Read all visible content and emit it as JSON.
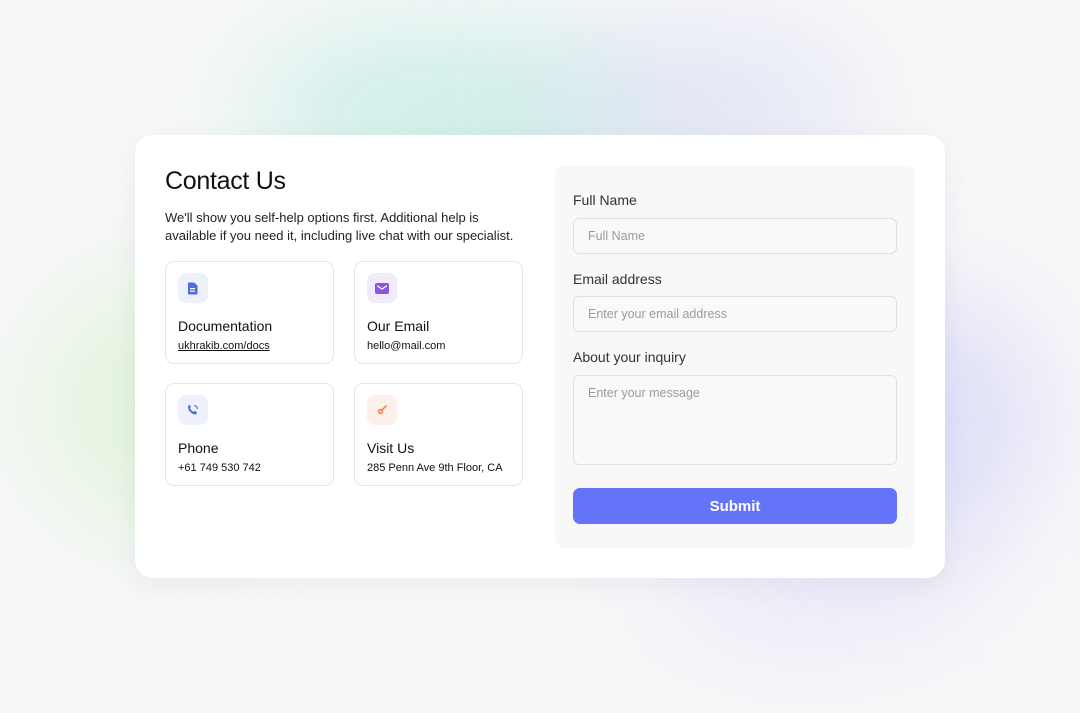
{
  "contact": {
    "title": "Contact Us",
    "subtitle": "We'll show you self-help options first. Additional help is available if you need it, including live chat with our specialist."
  },
  "info_cards": [
    {
      "title": "Documentation",
      "value": "ukhrakib.com/docs",
      "icon": "document-icon",
      "accent": "#4a6fd8",
      "icon_bg": "#eef1fb"
    },
    {
      "title": "Our Email",
      "value": "hello@mail.com",
      "icon": "mail-icon",
      "accent": "#8a55e0",
      "icon_bg": "#f1ebfc"
    },
    {
      "title": "Phone",
      "value": "+61 749 530 742",
      "icon": "phone-icon",
      "accent": "#4a6fd8",
      "icon_bg": "#eef1fb"
    },
    {
      "title": "Visit Us",
      "value": "285 Penn Ave 9th Floor, CA",
      "icon": "location-pin-icon",
      "accent": "#f08a5d",
      "icon_bg": "#fdf0ea"
    }
  ],
  "form": {
    "full_name": {
      "label": "Full Name",
      "placeholder": "Full Name",
      "value": ""
    },
    "email": {
      "label": "Email address",
      "placeholder": "Enter your email address",
      "value": ""
    },
    "inquiry": {
      "label": "About your inquiry",
      "placeholder": "Enter your message",
      "value": ""
    },
    "submit_label": "Submit"
  },
  "colors": {
    "primary": "#6374f8",
    "card_bg": "#ffffff",
    "panel_bg": "#f8f8f9"
  }
}
